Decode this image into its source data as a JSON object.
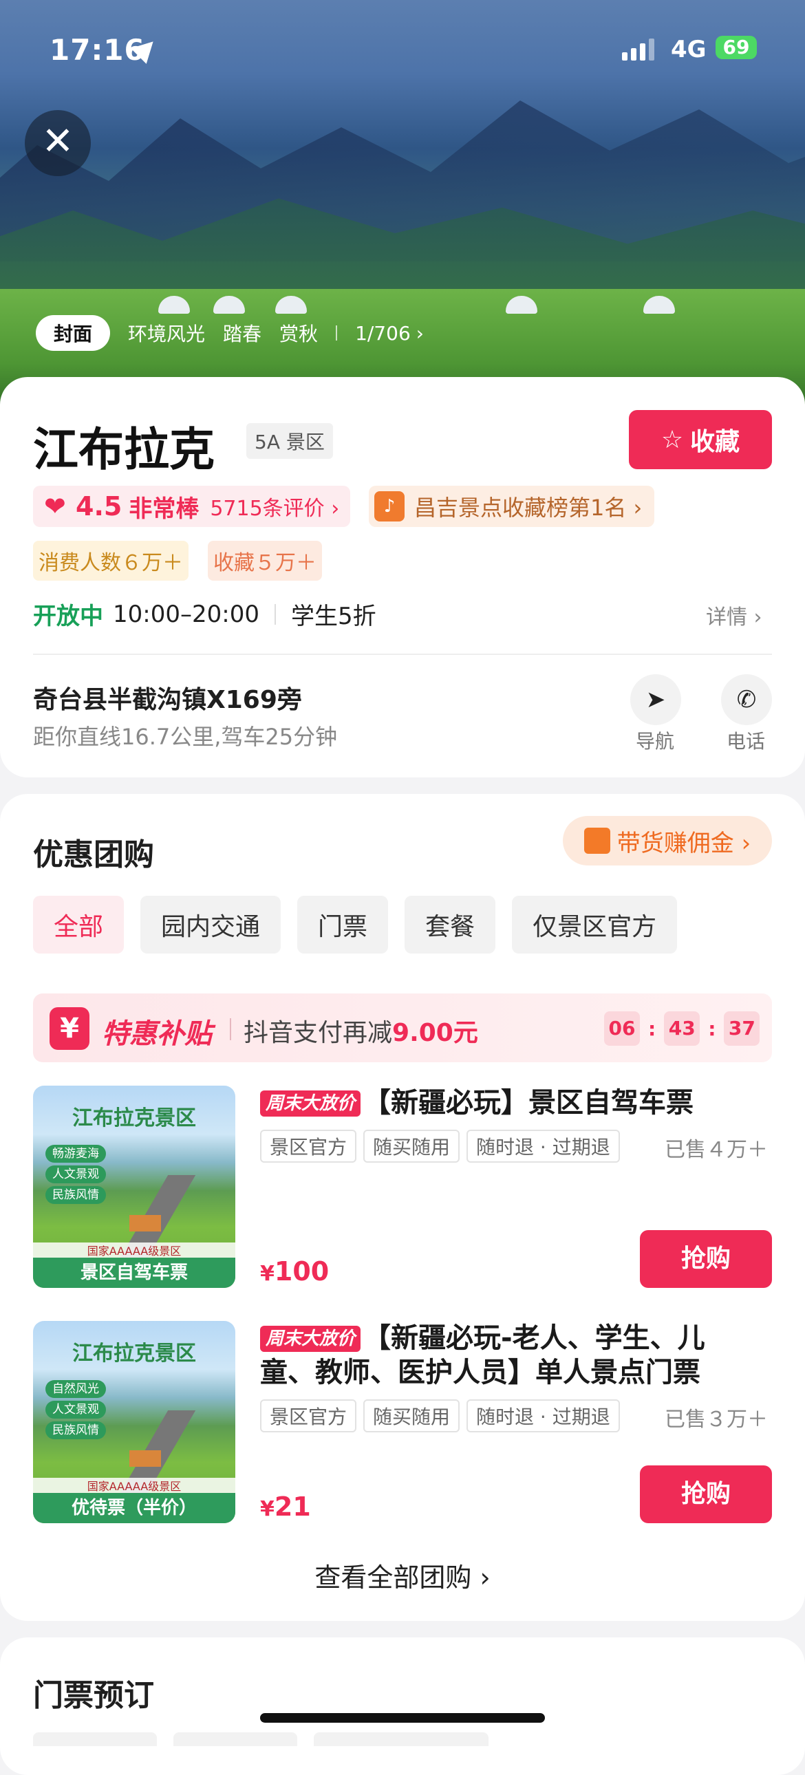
{
  "status_bar": {
    "time": "17:16",
    "network": "4G",
    "battery": "69"
  },
  "photo_tabs": {
    "items": [
      "封面",
      "环境风光",
      "踏春",
      "赏秋"
    ],
    "count": "1/706"
  },
  "attraction": {
    "name": "江布拉克",
    "level": "5A 景区",
    "favorite_label": "收藏",
    "rating_score": "4.5",
    "rating_word": "非常棒",
    "review_count": "5715条评价 ›",
    "rank_text": "昌吉景点收藏榜第1名 ›",
    "consumers": "消费人数６万＋",
    "collections": "收藏５万＋",
    "open_status": "开放中",
    "open_hours": "10:00–20:00",
    "discount": "学生5折",
    "detail_label": "详情 ›",
    "address": "奇台县半截沟镇X169旁",
    "distance": "距你直线16.7公里,驾车25分钟",
    "nav_label": "导航",
    "phone_label": "电话"
  },
  "group_buy": {
    "title": "优惠团购",
    "commission": "带货赚佣金 ›",
    "filters": [
      "全部",
      "园内交通",
      "门票",
      "套餐",
      "仅景区官方"
    ],
    "subsidy_brand": "特惠补贴",
    "subsidy_text": "抖音支付再减",
    "subsidy_amount": "9.00元",
    "timer": [
      "06",
      "43",
      "37"
    ],
    "products": [
      {
        "thumb_name": "江布拉克景区",
        "thumb_tags": [
          "畅游麦海",
          "人文景观",
          "民族风情"
        ],
        "thumb_level": "国家AAAAA级景区",
        "thumb_banner": "景区自驾车票",
        "weekend_tag": "周末大放价",
        "title": "【新疆必玩】景区自驾车票",
        "tags": [
          "景区官方",
          "随买随用",
          "随时退 · 过期退"
        ],
        "sold": "已售４万＋",
        "price_symbol": "¥",
        "price": "100",
        "buy_label": "抢购"
      },
      {
        "thumb_name": "江布拉克景区",
        "thumb_tags": [
          "自然风光",
          "人文景观",
          "民族风情"
        ],
        "thumb_level": "国家AAAAA级景区",
        "thumb_banner": "优待票（半价）",
        "weekend_tag": "周末大放价",
        "title": "【新疆必玩-老人、学生、儿童、教师、医护人员】单人景点门票",
        "tags": [
          "景区官方",
          "随买随用",
          "随时退 · 过期退"
        ],
        "sold": "已售３万＋",
        "price_symbol": "¥",
        "price": "21",
        "buy_label": "抢购"
      }
    ],
    "see_all": "查看全部团购 ›"
  },
  "ticket_booking": {
    "title": "门票预订"
  },
  "colors": {
    "accent": "#ef2b56",
    "open_green": "#18a058",
    "commission_orange": "#ef6a20"
  },
  "icons": [
    "close-icon",
    "location-arrow-icon",
    "star-icon",
    "heart-icon",
    "douyin-icon",
    "navigate-icon",
    "phone-icon",
    "shopping-bag-icon",
    "yen-icon",
    "chevron-right-icon"
  ]
}
